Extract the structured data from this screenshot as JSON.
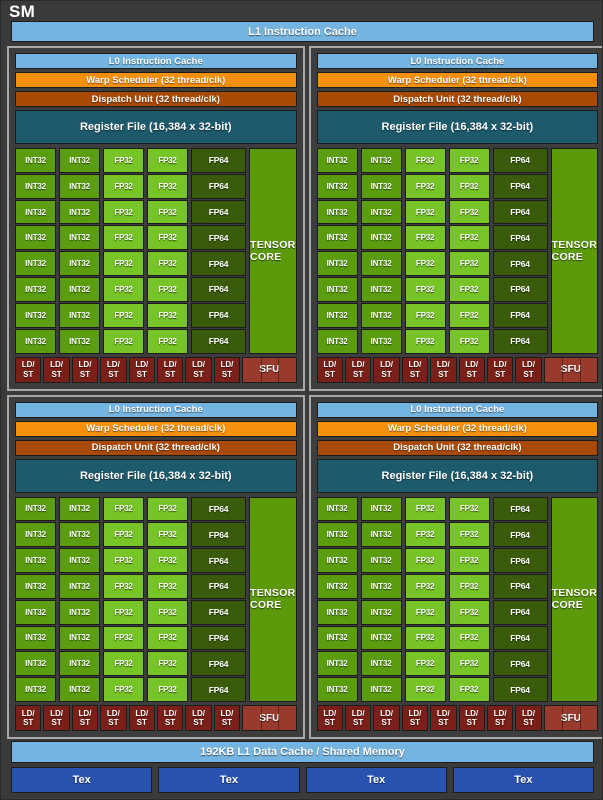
{
  "diagram": {
    "title": "SM",
    "top_cache": {
      "label": "L1 Instruction Cache",
      "color": "#74b4e0"
    },
    "bottom_cache": {
      "label": "192KB L1 Data Cache / Shared Memory",
      "color": "#74b4e0"
    },
    "tex_units": [
      {
        "label": "Tex"
      },
      {
        "label": "Tex"
      },
      {
        "label": "Tex"
      },
      {
        "label": "Tex"
      }
    ],
    "processing_block": {
      "l0_cache": "L0 Instruction Cache",
      "warp_scheduler": "Warp Scheduler (32 thread/clk)",
      "dispatch_unit": "Dispatch Unit (32 thread/clk)",
      "register_file": "Register File (16,384 x 32-bit)",
      "tensor_core": "TENSOR CORE",
      "int32_label": "INT32",
      "fp32_label": "FP32",
      "fp64_label": "FP64",
      "ldst_label_top": "LD/",
      "ldst_label_bottom": "ST",
      "sfu_label": "SFU",
      "rows": 8,
      "int32_per_row": 2,
      "fp32_per_row": 2,
      "fp64_per_row": 1,
      "ldst_count": 8,
      "sfu_count": 1
    },
    "quadrant_count": 4,
    "colors": {
      "background": "#3a3a3a",
      "quadrant_panel": "#3d3d3d",
      "quadrant_border": "#a9a9a9",
      "cache_blue": "#74b4e0",
      "warp_orange": "#f5900c",
      "dispatch_brown": "#a84a06",
      "register_teal": "#1d5a6b",
      "int32_green": "#5a9e0f",
      "fp32_green": "#76c425",
      "fp64_green": "#3a5c0a",
      "tensor_green": "#5d9a0b",
      "ldst_red": "#7a2018",
      "sfu_red": "#983a2c",
      "tex_blue": "#2a52b0",
      "text": "#ffffff"
    }
  }
}
